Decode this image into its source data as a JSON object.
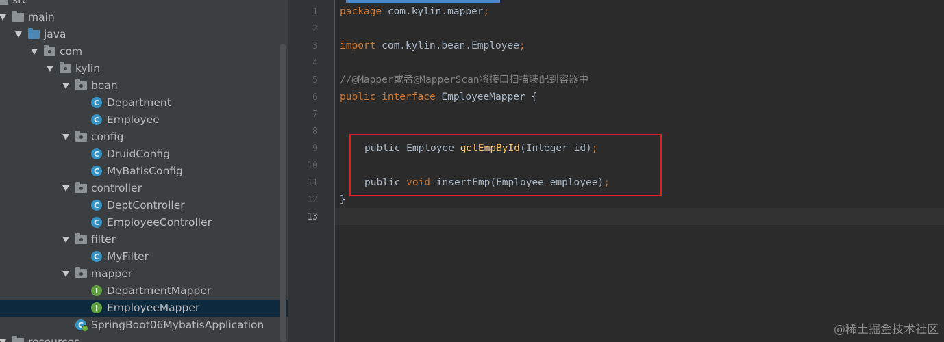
{
  "tree": {
    "items": [
      {
        "label": "src",
        "kind": "folder-plain",
        "arrow": false
      },
      {
        "label": "main",
        "kind": "folder-plain",
        "arrow": true
      },
      {
        "label": "java",
        "kind": "folder-src",
        "arrow": true
      },
      {
        "label": "com",
        "kind": "folder-pkg",
        "arrow": true
      },
      {
        "label": "kylin",
        "kind": "folder-pkg",
        "arrow": true
      },
      {
        "label": "bean",
        "kind": "folder-pkg",
        "arrow": true
      },
      {
        "label": "Department",
        "kind": "class",
        "arrow": false
      },
      {
        "label": "Employee",
        "kind": "class",
        "arrow": false
      },
      {
        "label": "config",
        "kind": "folder-pkg",
        "arrow": true
      },
      {
        "label": "DruidConfig",
        "kind": "class",
        "arrow": false
      },
      {
        "label": "MyBatisConfig",
        "kind": "class",
        "arrow": false
      },
      {
        "label": "controller",
        "kind": "folder-pkg",
        "arrow": true
      },
      {
        "label": "DeptController",
        "kind": "class",
        "arrow": false
      },
      {
        "label": "EmployeeController",
        "kind": "class",
        "arrow": false
      },
      {
        "label": "filter",
        "kind": "folder-pkg",
        "arrow": true
      },
      {
        "label": "MyFilter",
        "kind": "class",
        "arrow": false
      },
      {
        "label": "mapper",
        "kind": "folder-pkg",
        "arrow": true
      },
      {
        "label": "DepartmentMapper",
        "kind": "interface",
        "arrow": false
      },
      {
        "label": "EmployeeMapper",
        "kind": "interface",
        "arrow": false,
        "selected": true
      },
      {
        "label": "SpringBoot06MybatisApplication",
        "kind": "spring",
        "arrow": false
      },
      {
        "label": "resources",
        "kind": "folder-plain",
        "arrow": true
      }
    ]
  },
  "editor": {
    "line_numbers": [
      "1",
      "2",
      "3",
      "4",
      "5",
      "6",
      "7",
      "8",
      "9",
      "10",
      "11",
      "12",
      "13"
    ],
    "current_line": "13",
    "lines": {
      "l1": {
        "kw": "package",
        "rest": " com.kylin.mapper",
        "end": ";"
      },
      "l3": {
        "kw": "import",
        "rest": " com.kylin.bean.Employee",
        "end": ";"
      },
      "l5": {
        "comment": "//@Mapper或者@MapperScan将接口扫描装配到容器中"
      },
      "l6": {
        "kw1": "public",
        "kw2": " interface",
        "rest": " EmployeeMapper {"
      },
      "l9": {
        "kw": "public",
        "type": " Employee ",
        "fn": "getEmpById",
        "rest": "(Integer id)",
        "end": ";"
      },
      "l11": {
        "kw": "public",
        "kw2": " void",
        "rest": " insertEmp(Employee employee)",
        "end": ";"
      },
      "l12": {
        "rest": "}"
      }
    }
  },
  "watermark": "@稀土掘金技术社区",
  "colors": {
    "highlight_box": "#e02020",
    "keyword": "#cc7832",
    "comment": "#808080",
    "method": "#ffc66d",
    "text": "#a9b7c6"
  }
}
